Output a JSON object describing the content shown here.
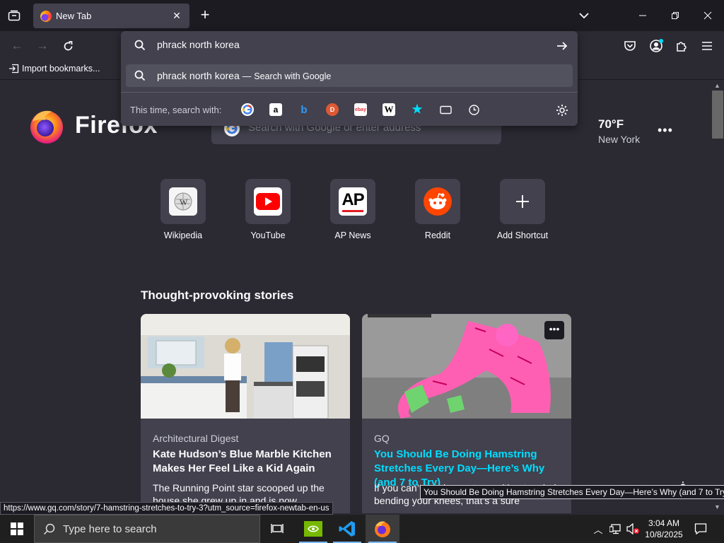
{
  "browser": {
    "tab": {
      "title": "New Tab"
    },
    "new_tab_symbol": "+",
    "window_controls": [
      "minimize-icon",
      "maximize-icon",
      "close-icon"
    ],
    "bookmarks": {
      "import_label": "Import bookmarks..."
    }
  },
  "urlbar": {
    "query": "phrack north korea",
    "suggestion": {
      "query": "phrack north korea",
      "separator": "—",
      "action": "Search with Google"
    },
    "oneoff_label": "This time, search with:",
    "engines": [
      "google",
      "amazon",
      "bing",
      "duckduckgo",
      "ebay",
      "wikipedia",
      "bookmarks",
      "tabs",
      "history"
    ]
  },
  "newtab": {
    "wordmark": "Firefox",
    "search_placeholder": "Search with Google or enter address",
    "weather": {
      "temp": "70°F",
      "city": "New York"
    },
    "shortcuts": [
      {
        "label": "Wikipedia"
      },
      {
        "label": "YouTube"
      },
      {
        "label": "AP News",
        "logo_text": "AP"
      },
      {
        "label": "Reddit"
      },
      {
        "label": "Add Shortcut"
      }
    ],
    "stories_title": "Thought-provoking stories",
    "stories": [
      {
        "source": "Architectural Digest",
        "headline": "Kate Hudson’s Blue Marble Kitchen Makes Her Feel Like a Kid Again",
        "excerpt": "The Running Point star scooped up the house she grew up in and is now"
      },
      {
        "source": "GQ",
        "headline": "You Should Be Doing Hamstring Stretches Every Day—Here’s Why (and 7 to Try)",
        "excerpt": "If you can’t touch your toes without majorly bending your knees, that’s a sure"
      }
    ]
  },
  "status_url": "https://www.gq.com/story/7-hamstring-stretches-to-try-3?utm_source=firefox-newtab-en-us",
  "tooltip": "You Should Be Doing Hamstring Stretches Every Day—Here’s Why (and 7 to Try)",
  "taskbar": {
    "search_placeholder": "Type here to search",
    "time": "3:04 AM",
    "date": "10/8/2025"
  },
  "colors": {
    "accent_link": "#00ddff",
    "page_bg": "#2b2a33",
    "toolbar_dark": "#1c1b22",
    "card_bg": "#42414d"
  }
}
